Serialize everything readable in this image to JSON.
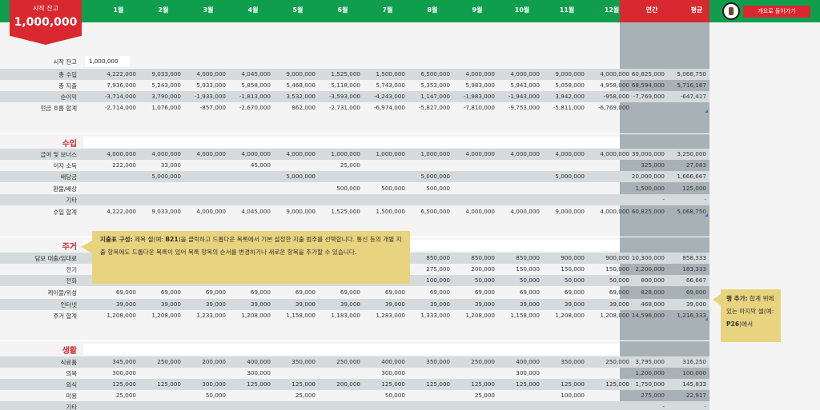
{
  "header": {
    "start_label": "시작 잔고",
    "start_value": "1,000,000",
    "months": [
      "1월",
      "2월",
      "3월",
      "4월",
      "5월",
      "6월",
      "7월",
      "8월",
      "9월",
      "10월",
      "11월",
      "12월"
    ],
    "annual": "연간",
    "average": "평균",
    "back_button": "개요로 돌아가기"
  },
  "summary": {
    "start_row": {
      "label": "시작 잔고",
      "value": "1,000,000"
    },
    "rows": [
      {
        "label": "총 수입",
        "values": [
          "4,222,000",
          "9,033,000",
          "4,000,000",
          "4,045,000",
          "9,000,000",
          "1,525,000",
          "1,500,000",
          "6,500,000",
          "4,000,000",
          "4,000,000",
          "9,000,000",
          "4,000,000"
        ],
        "annual": "60,825,000",
        "avg": "5,068,750"
      },
      {
        "label": "총 지출",
        "values": [
          "7,936,000",
          "5,243,000",
          "5,933,000",
          "5,858,000",
          "5,468,000",
          "5,118,000",
          "5,743,000",
          "5,353,000",
          "5,983,000",
          "5,943,000",
          "5,058,000",
          "4,958,000"
        ],
        "annual": "68,594,000",
        "avg": "5,716,167"
      },
      {
        "label": "순이익",
        "values": [
          "-3,714,000",
          "3,790,000",
          "-1,933,000",
          "-1,813,000",
          "3,532,000",
          "-3,593,000",
          "-4,243,000",
          "1,147,000",
          "-1,983,000",
          "-1,943,000",
          "3,942,000",
          "-958,000"
        ],
        "annual": "-7,769,000",
        "avg": "-647,417"
      },
      {
        "label": "현금 흐름 합계",
        "values": [
          "-2,714,000",
          "1,076,000",
          "-857,000",
          "-2,670,000",
          "862,000",
          "-2,731,000",
          "-6,974,000",
          "-5,827,000",
          "-7,810,000",
          "-9,753,000",
          "-5,811,000",
          "-6,769,000"
        ],
        "annual": "",
        "avg": ""
      }
    ]
  },
  "income": {
    "title": "수입",
    "rows": [
      {
        "label": "급여 및 보너스",
        "values": [
          "4,000,000",
          "4,000,000",
          "4,000,000",
          "4,000,000",
          "4,000,000",
          "1,000,000",
          "1,000,000",
          "1,000,000",
          "4,000,000",
          "4,000,000",
          "4,000,000",
          "4,000,000"
        ],
        "annual": "39,000,000",
        "avg": "3,250,000"
      },
      {
        "label": "이자 소득",
        "values": [
          "222,000",
          "33,000",
          "",
          "45,000",
          "",
          "25,000",
          "",
          "",
          "",
          "",
          "",
          ""
        ],
        "annual": "325,000",
        "avg": "27,083"
      },
      {
        "label": "배당금",
        "values": [
          "",
          "5,000,000",
          "",
          "",
          "5,000,000",
          "",
          "",
          "5,000,000",
          "",
          "",
          "5,000,000",
          ""
        ],
        "annual": "20,000,000",
        "avg": "1,666,667"
      },
      {
        "label": "환불/배상",
        "values": [
          "",
          "",
          "",
          "",
          "",
          "500,000",
          "500,000",
          "500,000",
          "",
          "",
          "",
          ""
        ],
        "annual": "1,500,000",
        "avg": "125,000"
      },
      {
        "label": "기타",
        "values": [
          "",
          "",
          "",
          "",
          "",
          "",
          "",
          "",
          "",
          "",
          "",
          ""
        ],
        "annual": "-",
        "avg": "-"
      },
      {
        "label": "수입 합계",
        "values": [
          "4,222,000",
          "9,033,000",
          "4,000,000",
          "4,045,000",
          "9,000,000",
          "1,525,000",
          "1,500,000",
          "6,500,000",
          "4,000,000",
          "4,000,000",
          "9,000,000",
          "4,000,000"
        ],
        "annual": "60,825,000",
        "avg": "5,068,750"
      }
    ]
  },
  "housing": {
    "title": "주거",
    "rows": [
      {
        "label": "담보 대출/임대료",
        "values": [
          "",
          "",
          "",
          "",
          "",
          "",
          "",
          "850,000",
          "850,000",
          "850,000",
          "900,000",
          "900,000"
        ],
        "annual": "10,300,000",
        "avg": "858,333"
      },
      {
        "label": "전기",
        "values": [
          "",
          "",
          "",
          "",
          "",
          "",
          "",
          "275,000",
          "200,000",
          "150,000",
          "150,000",
          "150,000"
        ],
        "annual": "2,200,000",
        "avg": "183,333"
      },
      {
        "label": "전화",
        "values": [
          "",
          "",
          "",
          "",
          "",
          "",
          "",
          "100,000",
          "50,000",
          "50,000",
          "50,000",
          "50,000"
        ],
        "annual": "800,000",
        "avg": "66,667"
      },
      {
        "label": "케이블/위성",
        "values": [
          "69,000",
          "69,000",
          "69,000",
          "69,000",
          "69,000",
          "69,000",
          "69,000",
          "69,000",
          "69,000",
          "69,000",
          "69,000",
          "69,000"
        ],
        "annual": "828,000",
        "avg": "69,000"
      },
      {
        "label": "인터넷",
        "values": [
          "39,000",
          "39,000",
          "39,000",
          "39,000",
          "39,000",
          "39,000",
          "39,000",
          "39,000",
          "39,000",
          "39,000",
          "39,000",
          "39,000"
        ],
        "annual": "468,000",
        "avg": "39,000"
      },
      {
        "label": "주거 합계",
        "values": [
          "1,208,000",
          "1,208,000",
          "1,233,000",
          "1,208,000",
          "1,158,000",
          "1,183,000",
          "1,283,000",
          "1,333,000",
          "1,208,000",
          "1,158,000",
          "1,208,000",
          "1,208,000"
        ],
        "annual": "14,596,000",
        "avg": "1,216,333"
      }
    ]
  },
  "living": {
    "title": "생활",
    "rows": [
      {
        "label": "식료품",
        "values": [
          "345,000",
          "250,000",
          "200,000",
          "400,000",
          "350,000",
          "250,000",
          "400,000",
          "350,000",
          "250,000",
          "400,000",
          "350,000",
          "250,000"
        ],
        "annual": "3,795,000",
        "avg": "316,250"
      },
      {
        "label": "의복",
        "values": [
          "300,000",
          "",
          "",
          "300,000",
          "",
          "",
          "300,000",
          "",
          "",
          "300,000",
          "",
          ""
        ],
        "annual": "1,200,000",
        "avg": "100,000"
      },
      {
        "label": "외식",
        "values": [
          "125,000",
          "125,000",
          "300,000",
          "125,000",
          "125,000",
          "200,000",
          "125,000",
          "125,000",
          "125,000",
          "125,000",
          "125,000",
          "125,000"
        ],
        "annual": "1,750,000",
        "avg": "145,833"
      },
      {
        "label": "미용",
        "values": [
          "25,000",
          "",
          "50,000",
          "",
          "25,000",
          "",
          "50,000",
          "",
          "25,000",
          "",
          "100,000",
          ""
        ],
        "annual": "275,000",
        "avg": "22,917"
      },
      {
        "label": "기타",
        "values": [
          "",
          "",
          "",
          "",
          "",
          "",
          "",
          "",
          "",
          "",
          "",
          ""
        ],
        "annual": "-",
        "avg": "-"
      }
    ]
  },
  "callout_expense": {
    "bold": "지출표 구성:",
    "text1": " 제목 셀(예: ",
    "bold2": "B21",
    "text2": ")을 클릭하고 드롭다운 목록에서 기본 설정한 지출 범주를 선택합니다. 통신 등의 개별 지출 항목에도 드롭다운 목록이 있어 목록 항목의 순서를 변경하거나 새로운 항목을 추가할 수 있습니다."
  },
  "callout_addrow": {
    "bold": "행 추가:",
    "text1": " 합계 위에 있는 마지막 셀(예: ",
    "bold2": "P26",
    "text2": ")에서"
  }
}
